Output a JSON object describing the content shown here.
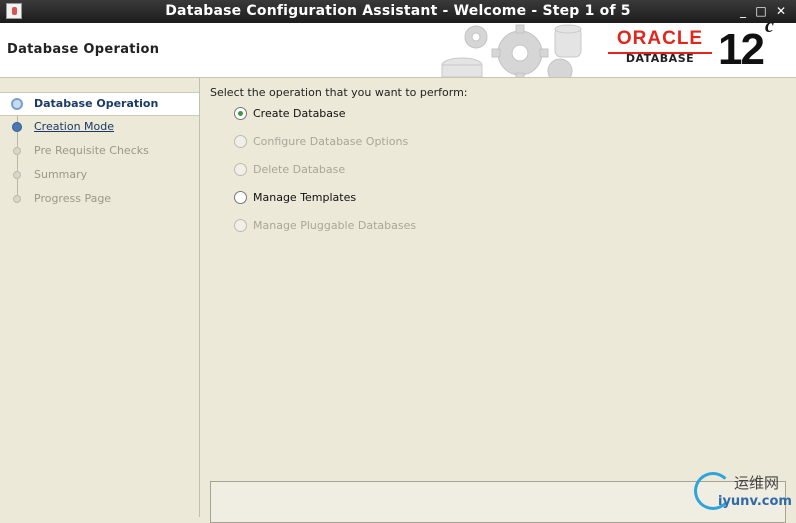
{
  "window": {
    "title": "Database Configuration Assistant - Welcome - Step 1 of 5",
    "controls": {
      "minimize": "_",
      "maximize": "□",
      "close": "✕"
    }
  },
  "header": {
    "section_title": "Database Operation",
    "logo": {
      "brand": "ORACLE",
      "product": "DATABASE",
      "version": "12",
      "version_suffix": "c"
    }
  },
  "sidebar": {
    "steps": [
      {
        "label": "Database Operation",
        "state": "active"
      },
      {
        "label": "Creation Mode",
        "state": "done"
      },
      {
        "label": "Pre Requisite Checks",
        "state": "pending"
      },
      {
        "label": "Summary",
        "state": "pending"
      },
      {
        "label": "Progress Page",
        "state": "pending"
      }
    ]
  },
  "main": {
    "prompt": "Select the operation that you want to perform:",
    "options": [
      {
        "label": "Create Database",
        "selected": true,
        "enabled": true
      },
      {
        "label": "Configure Database Options",
        "selected": false,
        "enabled": false
      },
      {
        "label": "Delete Database",
        "selected": false,
        "enabled": false
      },
      {
        "label": "Manage Templates",
        "selected": false,
        "enabled": true
      },
      {
        "label": "Manage Pluggable Databases",
        "selected": false,
        "enabled": false
      }
    ]
  },
  "watermark": {
    "cn": "运维网",
    "url": "iyunv.com"
  },
  "colors": {
    "oracle_red": "#e1261c",
    "active_step": "#1b3a66",
    "selected_radio": "#3c9a3c"
  }
}
